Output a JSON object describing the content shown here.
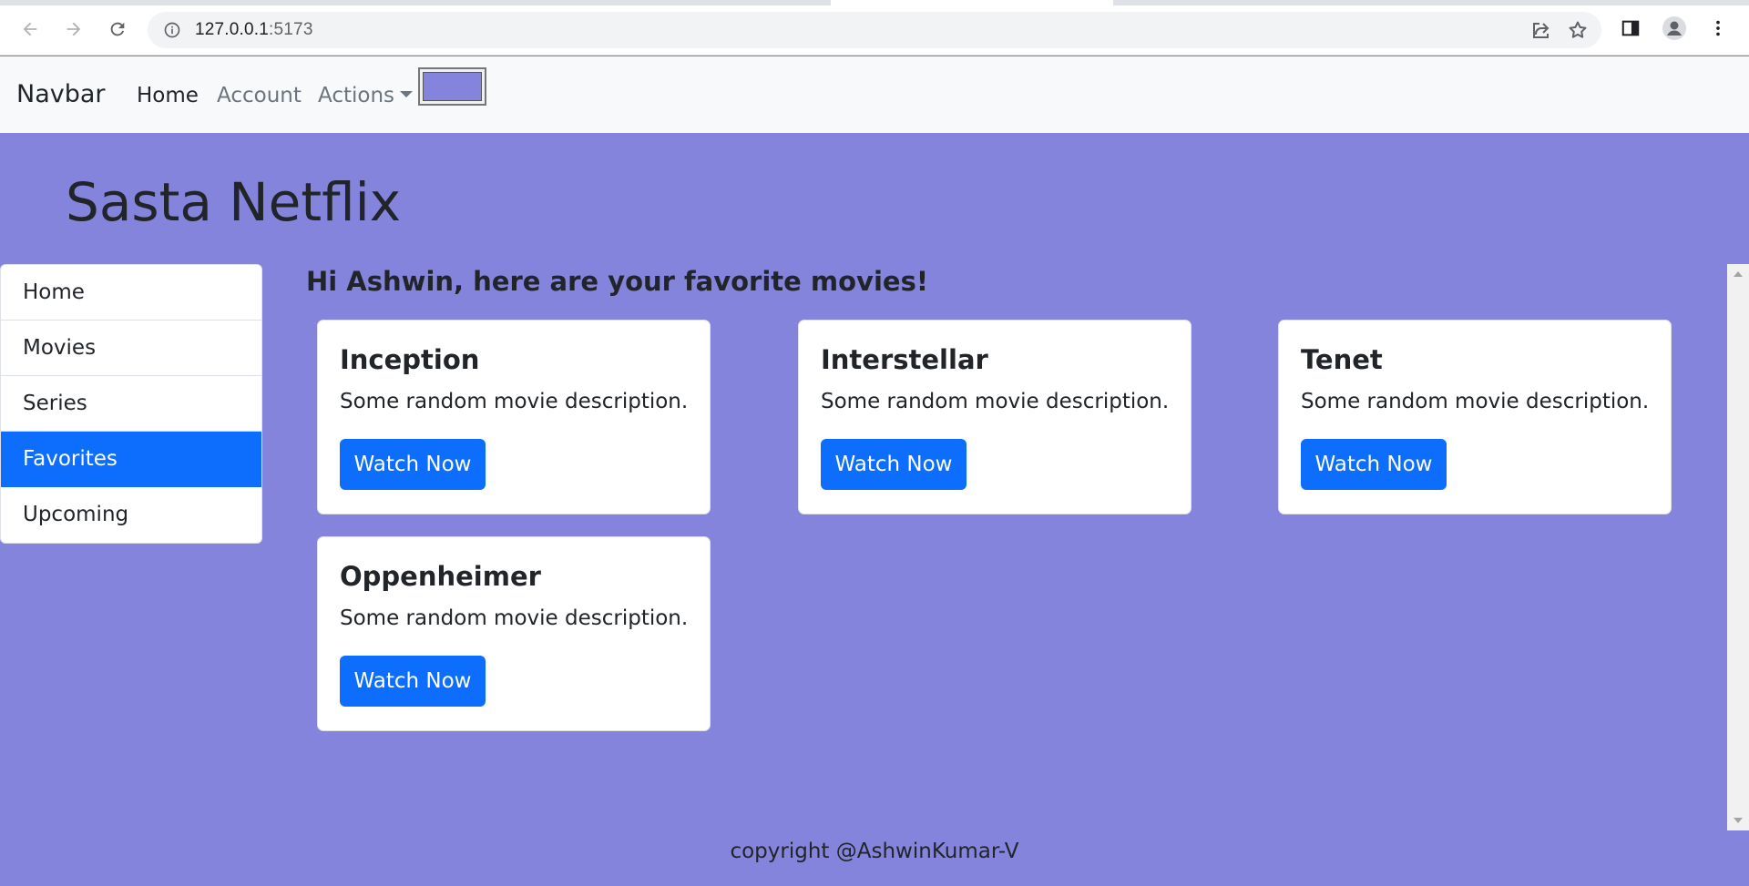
{
  "browser": {
    "url_host": "127.0.0.1",
    "url_port": ":5173"
  },
  "navbar": {
    "brand": "Navbar",
    "links": [
      {
        "label": "Home",
        "active": true
      },
      {
        "label": "Account",
        "active": false
      },
      {
        "label": "Actions",
        "active": false
      }
    ],
    "theme_color": "#8484dc"
  },
  "page": {
    "title": "Sasta Netflix",
    "greeting": "Hi Ashwin, here are your favorite movies!",
    "background_color": "#8484dc"
  },
  "sidebar": {
    "items": [
      {
        "label": "Home",
        "active": false
      },
      {
        "label": "Movies",
        "active": false
      },
      {
        "label": "Series",
        "active": false
      },
      {
        "label": "Favorites",
        "active": true
      },
      {
        "label": "Upcoming",
        "active": false
      }
    ],
    "active_color": "#0d6efd"
  },
  "movies": [
    {
      "title": "Inception",
      "description": "Some random movie description.",
      "button": "Watch Now"
    },
    {
      "title": "Interstellar",
      "description": "Some random movie description.",
      "button": "Watch Now"
    },
    {
      "title": "Tenet",
      "description": "Some random movie description.",
      "button": "Watch Now"
    },
    {
      "title": "Oppenheimer",
      "description": "Some random movie description.",
      "button": "Watch Now"
    }
  ],
  "footer": {
    "text": "copyright @AshwinKumar-V"
  },
  "icons": {
    "back": "arrow-left-icon",
    "forward": "arrow-right-icon",
    "reload": "reload-icon",
    "info": "info-icon",
    "share": "share-icon",
    "bookmark": "star-icon",
    "side_panel": "side-panel-icon",
    "profile": "profile-icon",
    "menu": "kebab-menu-icon"
  }
}
